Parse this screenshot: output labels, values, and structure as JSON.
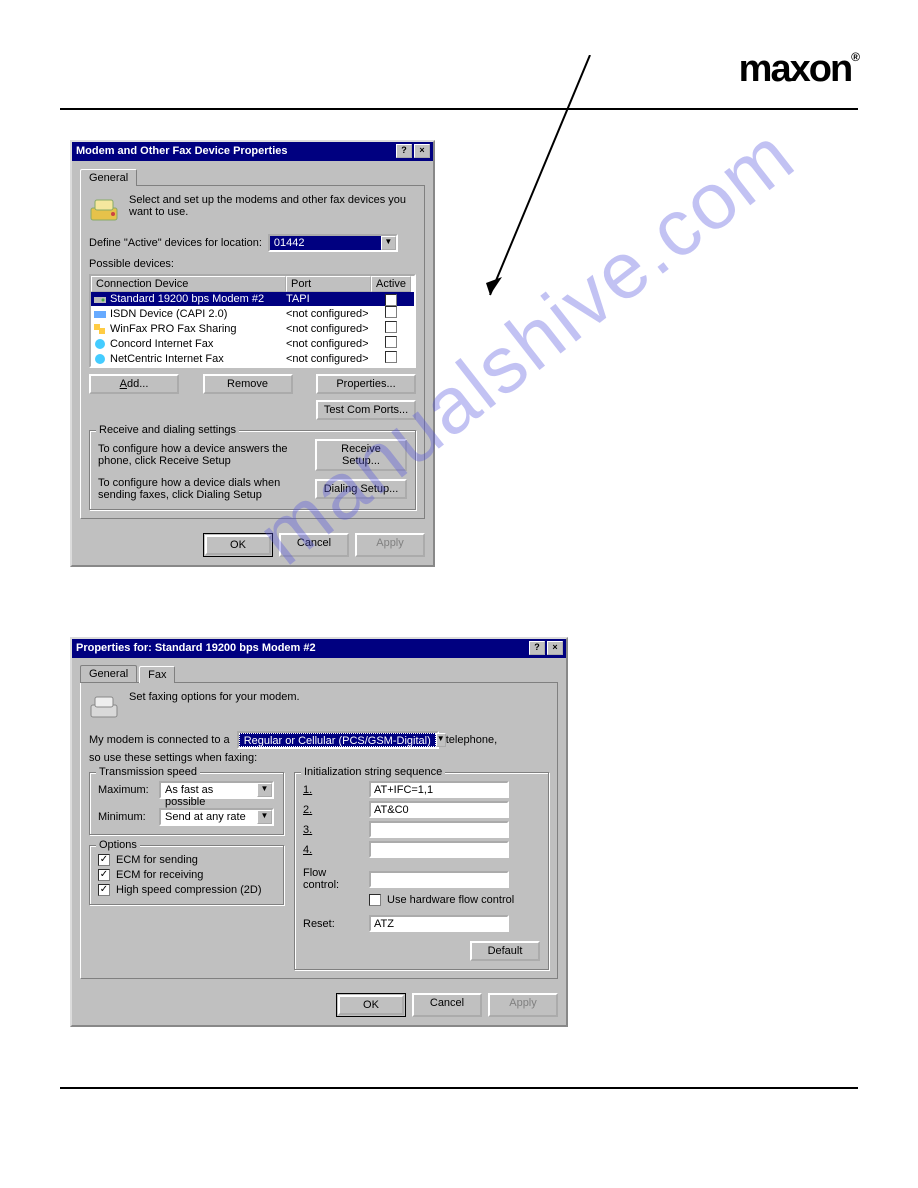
{
  "brand": "maxon",
  "watermark": "manualshive.com",
  "dialog1": {
    "title": "Modem and Other Fax Device Properties",
    "help": "?",
    "close": "×",
    "tab_general": "General",
    "instruction": "Select and set up the modems and other fax devices you want to use.",
    "define_label": "Define \"Active\" devices for location:",
    "location_value": "01442",
    "possible_label": "Possible devices:",
    "col_device": "Connection Device",
    "col_port": "Port",
    "col_active": "Active",
    "devices": [
      {
        "name": "Standard 19200 bps Modem #2",
        "port": "TAPI",
        "active": true,
        "selected": true
      },
      {
        "name": "ISDN Device (CAPI 2.0)",
        "port": "<not configured>",
        "active": false
      },
      {
        "name": "WinFax PRO Fax Sharing",
        "port": "<not configured>",
        "active": false
      },
      {
        "name": "Concord Internet Fax",
        "port": "<not configured>",
        "active": false
      },
      {
        "name": "NetCentric Internet Fax",
        "port": "<not configured>",
        "active": false
      }
    ],
    "btn_add": "Add...",
    "btn_remove": "Remove",
    "btn_properties": "Properties...",
    "btn_testcom": "Test Com Ports...",
    "group_title": "Receive and dialing settings",
    "recv_text": "To configure how a device answers the phone, click Receive Setup",
    "dial_text": "To configure how a device dials when sending faxes, click Dialing Setup",
    "btn_recv": "Receive Setup...",
    "btn_dial": "Dialing Setup...",
    "btn_ok": "OK",
    "btn_cancel": "Cancel",
    "btn_apply": "Apply"
  },
  "dialog2": {
    "title": "Properties for: Standard 19200 bps Modem #2",
    "help": "?",
    "close": "×",
    "tab_general": "General",
    "tab_fax": "Fax",
    "instruction": "Set faxing options for your modem.",
    "connected_pre": "My modem is connected to a",
    "connected_value": "Regular or Cellular (PCS/GSM-Digital)",
    "connected_post": "telephone,",
    "connected_line2": "so use these settings when faxing:",
    "group_trans": "Transmission speed",
    "max_label": "Maximum:",
    "max_value": "As fast as possible",
    "min_label": "Minimum:",
    "min_value": "Send at any rate",
    "group_opts": "Options",
    "opt_ecm_send": "ECM for sending",
    "opt_ecm_recv": "ECM for receiving",
    "opt_hsc": "High speed compression (2D)",
    "group_init": "Initialization string sequence",
    "init_1": "1.",
    "init_2": "2.",
    "init_3": "3.",
    "init_4": "4.",
    "init_v1": "AT+IFC=1,1",
    "init_v2": "AT&C0",
    "init_v3": "",
    "init_v4": "",
    "flow_label": "Flow control:",
    "flow_value": "",
    "hw_flow": "Use hardware flow control",
    "reset_label": "Reset:",
    "reset_value": "ATZ",
    "btn_default": "Default",
    "btn_ok": "OK",
    "btn_cancel": "Cancel",
    "btn_apply": "Apply"
  }
}
